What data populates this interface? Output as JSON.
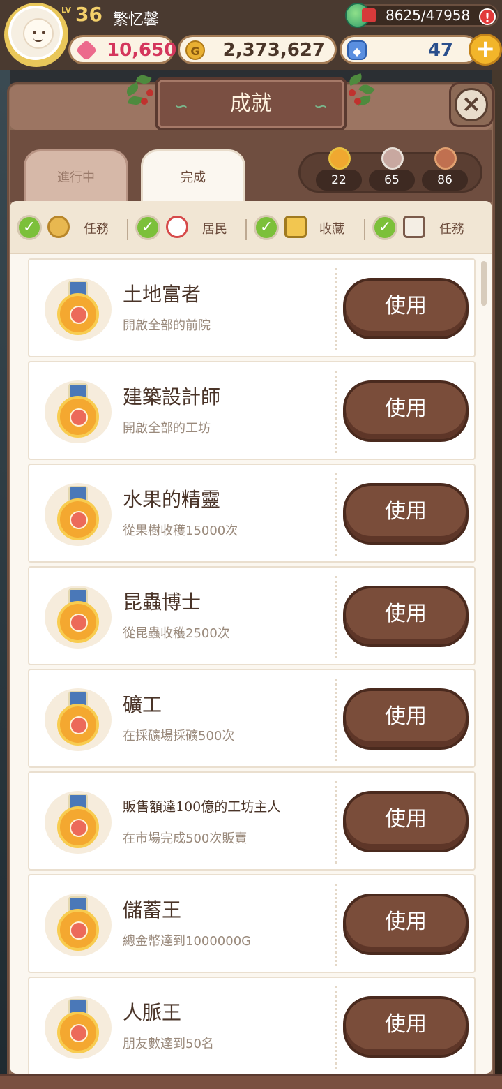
{
  "player": {
    "level_label": "LV",
    "level": "36",
    "name": "繁忆馨"
  },
  "energy": {
    "value": "8625/47958",
    "alert": "!"
  },
  "resources": {
    "hearts": "10,650",
    "gold": "2,373,627",
    "gems": "47",
    "add_label": "+"
  },
  "window": {
    "title": "成就",
    "close_label": "×"
  },
  "tabs": [
    {
      "label": "進行中"
    },
    {
      "label": "完成"
    }
  ],
  "medal_counts": [
    {
      "tier": "gold",
      "count": "22"
    },
    {
      "tier": "silver",
      "count": "65"
    },
    {
      "tier": "bronze",
      "count": "86"
    }
  ],
  "filters": [
    {
      "label": "任務",
      "icon": "quest-icon",
      "checked": true
    },
    {
      "label": "居民",
      "icon": "resident-icon",
      "checked": true
    },
    {
      "label": "收藏",
      "icon": "collection-icon",
      "checked": true
    },
    {
      "label": "任務",
      "icon": "calendar-icon",
      "checked": true
    }
  ],
  "achievements": [
    {
      "title": "土地富者",
      "desc": "開啟全部的前院",
      "button": "使用"
    },
    {
      "title": "建築設計師",
      "desc": "開啟全部的工坊",
      "button": "使用"
    },
    {
      "title": "水果的精靈",
      "desc": "從果樹收穫15000次",
      "button": "使用"
    },
    {
      "title": "昆蟲博士",
      "desc": "從昆蟲收穫2500次",
      "button": "使用"
    },
    {
      "title": "礦工",
      "desc": "在採礦場採礦500次",
      "button": "使用"
    },
    {
      "title": "販售額達100億的工坊主人",
      "desc": "在市場完成500次販賣",
      "button": "使用"
    },
    {
      "title": "儲蓄王",
      "desc": "總金幣達到1000000G",
      "button": "使用"
    },
    {
      "title": "人脈王",
      "desc": "朋友數達到50名",
      "button": "使用"
    }
  ],
  "colors": {
    "accent": "#7a4d3a",
    "panel": "#fbf7f0",
    "check": "#7cc03a"
  }
}
